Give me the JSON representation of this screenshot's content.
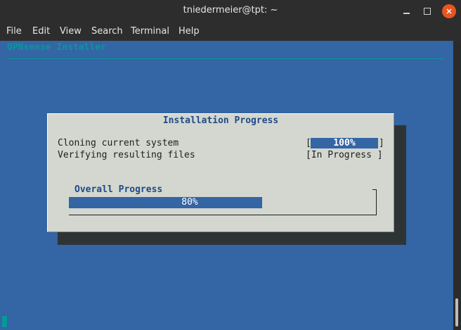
{
  "window": {
    "title": "tniedermeier@tpt: ~"
  },
  "menu": {
    "items": [
      "File",
      "Edit",
      "View",
      "Search",
      "Terminal",
      "Help"
    ]
  },
  "terminal": {
    "header": "OPNsense Installer",
    "dialog": {
      "title": "Installation Progress",
      "rows": [
        {
          "label": "Cloning current system",
          "status_open": "[",
          "status": "100%",
          "status_close": "]"
        },
        {
          "label": "Verifying resulting files",
          "status": "[In Progress ]"
        }
      ],
      "overall": {
        "label": "Overall Progress",
        "text": "80%",
        "progress": 0.8
      }
    }
  },
  "colors": {
    "terminal_bg": "#3465a4",
    "dialog_bg": "#d3d7cf",
    "accent": "#204a87",
    "header_cyan": "#06989a",
    "close_button": "#e95420"
  },
  "icons": {
    "minimize": "minimize-icon",
    "maximize": "maximize-icon",
    "close": "close-icon"
  }
}
